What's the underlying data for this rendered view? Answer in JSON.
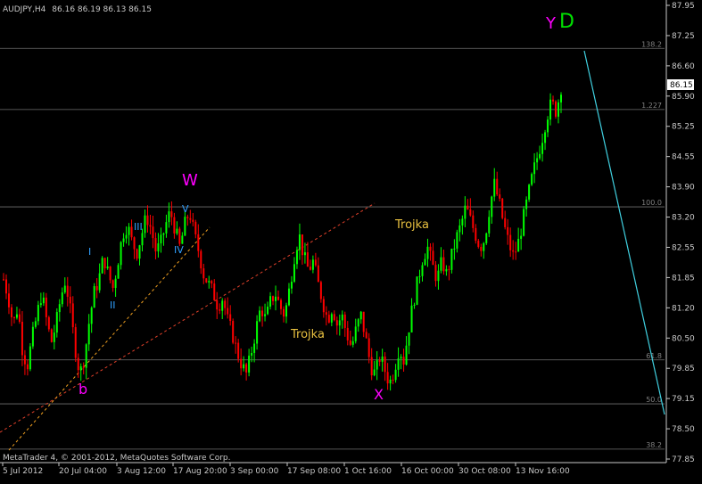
{
  "header": {
    "symbol": "AUDJPY,H4",
    "ohlc": "86.16 86.19 86.13 86.15"
  },
  "footer": {
    "copyright": "MetaTrader 4, © 2001-2012, MetaQuotes Software Corp."
  },
  "price_badge": "86.15",
  "colors": {
    "background": "#000000",
    "bull": "#00ff00",
    "bear": "#ff0000",
    "axis_text": "#c8c8c8",
    "fib_lines": "#808080",
    "trend_red": "#e0402a",
    "trend_orange": "#f0a020",
    "projection": "#40d0e0",
    "wave_major": "#ff00ff",
    "wave_minor": "#30a0ff",
    "trojka": "#e8c040",
    "d_label": "#00e000"
  },
  "chart_data": {
    "type": "candlestick",
    "symbol": "AUDJPY",
    "timeframe": "H4",
    "ylim": [
      77.95,
      87.95
    ],
    "y_ticks": [
      "87.95",
      "87.25",
      "86.60",
      "85.90",
      "85.25",
      "84.55",
      "83.90",
      "83.20",
      "82.55",
      "81.85",
      "81.20",
      "80.50",
      "79.85",
      "79.15",
      "78.50",
      "77.85"
    ],
    "x_ticks": [
      "5 Jul 2012",
      "20 Jul 04:00",
      "3 Aug 12:00",
      "17 Aug 20:00",
      "3 Sep 00:00",
      "17 Sep 08:00",
      "1 Oct 16:00",
      "16 Oct 00:00",
      "30 Oct 08:00",
      "13 Nov 16:00"
    ],
    "fib_levels": [
      {
        "label": "138.2",
        "price": 87.0
      },
      {
        "label": "1.227",
        "price": 85.65
      },
      {
        "label": "100.0",
        "price": 83.5
      },
      {
        "label": "61.8",
        "price": 80.12
      },
      {
        "label": "50.0",
        "price": 79.15
      },
      {
        "label": "38.2",
        "price": 78.15
      }
    ],
    "wave_labels": [
      {
        "text": "W",
        "kind": "major"
      },
      {
        "text": "X",
        "kind": "major"
      },
      {
        "text": "Y",
        "kind": "major"
      },
      {
        "text": "b",
        "kind": "major"
      },
      {
        "text": "D",
        "kind": "d"
      },
      {
        "text": "I",
        "kind": "minor"
      },
      {
        "text": "II",
        "kind": "minor"
      },
      {
        "text": "III",
        "kind": "minor"
      },
      {
        "text": "IV",
        "kind": "minor"
      },
      {
        "text": "V",
        "kind": "minor"
      },
      {
        "text": "Trojka",
        "kind": "trojka"
      },
      {
        "text": "Trojka",
        "kind": "trojka"
      }
    ],
    "price_path": [
      81.9,
      81.5,
      80.9,
      81.3,
      80.3,
      80.0,
      80.6,
      81.1,
      81.6,
      81.0,
      80.5,
      80.9,
      81.5,
      81.9,
      81.2,
      80.4,
      79.8,
      80.2,
      81.0,
      81.6,
      81.9,
      82.4,
      82.0,
      81.7,
      82.3,
      82.9,
      83.1,
      82.7,
      82.5,
      82.9,
      83.3,
      83.0,
      82.5,
      82.7,
      83.1,
      83.4,
      83.0,
      82.6,
      83.1,
      83.4,
      82.9,
      82.5,
      82.0,
      81.8,
      81.6,
      81.3,
      81.5,
      81.0,
      80.7,
      80.3,
      80.0,
      79.8,
      80.3,
      80.8,
      81.3,
      81.0,
      81.4,
      81.6,
      81.3,
      81.1,
      81.7,
      82.4,
      82.9,
      82.4,
      82.1,
      82.3,
      81.8,
      81.4,
      81.0,
      81.3,
      80.9,
      81.1,
      80.7,
      80.4,
      80.8,
      81.1,
      80.6,
      80.0,
      79.8,
      80.2,
      79.9,
      79.6,
      79.9,
      80.4,
      80.1,
      80.8,
      81.4,
      81.9,
      82.4,
      82.6,
      82.2,
      81.9,
      82.3,
      82.0,
      82.4,
      82.8,
      83.1,
      83.5,
      83.2,
      82.9,
      82.6,
      82.8,
      83.5,
      84.0,
      83.6,
      83.1,
      82.7,
      82.4,
      82.7,
      83.2,
      83.7,
      84.2,
      84.6,
      85.0,
      85.5,
      85.8,
      85.6,
      86.15
    ]
  },
  "annotations": {
    "trojka_upper": "Trojka",
    "trojka_lower": "Trojka"
  }
}
